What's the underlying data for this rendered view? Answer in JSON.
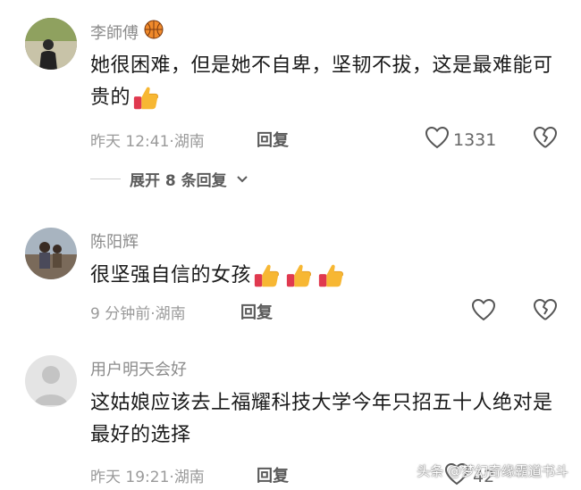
{
  "comments": [
    {
      "username": "李師傅",
      "badge_icon": "basketball-icon",
      "text": "她很困难，但是她不自卑，坚韧不拔，这是最难能可贵的",
      "reactions": [
        "thumbs-up-icon"
      ],
      "time": "昨天 12:41",
      "location": "湖南",
      "reply_label": "回复",
      "likes": "1331",
      "expand_label": "展开 8 条回复"
    },
    {
      "username": "陈阳辉",
      "text": "很坚强自信的女孩",
      "reactions": [
        "thumbs-up-icon",
        "thumbs-up-icon",
        "thumbs-up-icon"
      ],
      "time": "9 分钟前",
      "location": "湖南",
      "reply_label": "回复",
      "likes": ""
    },
    {
      "username": "用户明天会好",
      "text": "这姑娘应该去上福耀科技大学今年只招五十人绝对是最好的选择",
      "time": "昨天 19:21",
      "location": "湖南",
      "reply_label": "回复",
      "likes": "42"
    }
  ],
  "separator": "·",
  "watermark": "头条 @梦幻奇缘霸道书斗"
}
